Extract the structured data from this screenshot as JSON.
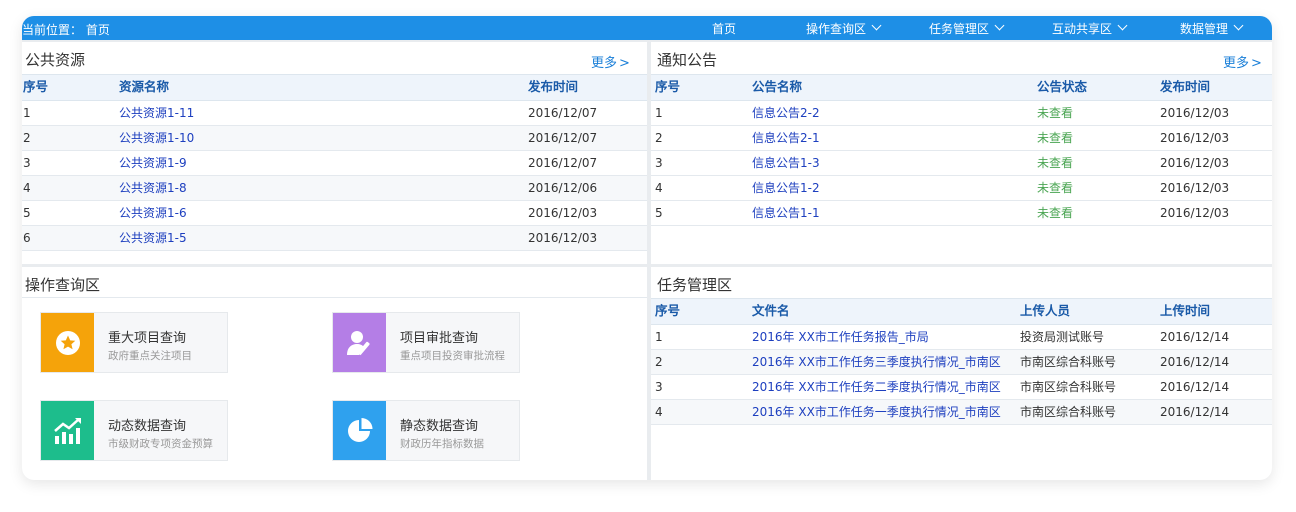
{
  "topbar": {
    "location_label": "当前位置：",
    "location_value": "首页",
    "nav": [
      {
        "label": "首页"
      },
      {
        "label": "操作查询区"
      },
      {
        "label": "任务管理区"
      },
      {
        "label": "互动共享区"
      },
      {
        "label": "数据管理"
      }
    ]
  },
  "public_resources": {
    "title": "公共资源",
    "more": "更多",
    "more_arrow": ">",
    "headers": [
      "序号",
      "资源名称",
      "发布时间"
    ],
    "rows": [
      {
        "no": "1",
        "name": "公共资源1-11",
        "date": "2016/12/07"
      },
      {
        "no": "2",
        "name": "公共资源1-10",
        "date": "2016/12/07"
      },
      {
        "no": "3",
        "name": "公共资源1-9",
        "date": "2016/12/07"
      },
      {
        "no": "4",
        "name": "公共资源1-8",
        "date": "2016/12/06"
      },
      {
        "no": "5",
        "name": "公共资源1-6",
        "date": "2016/12/03"
      },
      {
        "no": "6",
        "name": "公共资源1-5",
        "date": "2016/12/03"
      }
    ]
  },
  "notices": {
    "title": "通知公告",
    "more": "更多",
    "more_arrow": ">",
    "headers": [
      "序号",
      "公告名称",
      "公告状态",
      "发布时间"
    ],
    "rows": [
      {
        "no": "1",
        "name": "信息公告2-2",
        "status": "未查看",
        "date": "2016/12/03"
      },
      {
        "no": "2",
        "name": "信息公告2-1",
        "status": "未查看",
        "date": "2016/12/03"
      },
      {
        "no": "3",
        "name": "信息公告1-3",
        "status": "未查看",
        "date": "2016/12/03"
      },
      {
        "no": "4",
        "name": "信息公告1-2",
        "status": "未查看",
        "date": "2016/12/03"
      },
      {
        "no": "5",
        "name": "信息公告1-1",
        "status": "未查看",
        "date": "2016/12/03"
      }
    ]
  },
  "operations": {
    "title": "操作查询区",
    "tiles": [
      {
        "title": "重大项目查询",
        "subtitle": "政府重点关注项目",
        "icon": "star-icon",
        "color": "#f5a30a"
      },
      {
        "title": "项目审批查询",
        "subtitle": "重点项目投资审批流程",
        "icon": "user-pen-icon",
        "color": "#b47ee6"
      },
      {
        "title": "动态数据查询",
        "subtitle": "市级财政专项资金预算",
        "icon": "trend-chart-icon",
        "color": "#1dbd8c"
      },
      {
        "title": "静态数据查询",
        "subtitle": "财政历年指标数据",
        "icon": "pie-chart-icon",
        "color": "#2fa1ee"
      }
    ]
  },
  "tasks": {
    "title": "任务管理区",
    "headers": [
      "序号",
      "文件名",
      "上传人员",
      "上传时间"
    ],
    "rows": [
      {
        "no": "1",
        "name": "2016年 XX市工作任务报告_市局",
        "uploader": "投资局测试账号",
        "date": "2016/12/14"
      },
      {
        "no": "2",
        "name": "2016年 XX市工作任务三季度执行情况_市南区",
        "uploader": "市南区综合科账号",
        "date": "2016/12/14"
      },
      {
        "no": "3",
        "name": "2016年 XX市工作任务二季度执行情况_市南区",
        "uploader": "市南区综合科账号",
        "date": "2016/12/14"
      },
      {
        "no": "4",
        "name": "2016年 XX市工作任务一季度执行情况_市南区",
        "uploader": "市南区综合科账号",
        "date": "2016/12/14"
      }
    ]
  }
}
